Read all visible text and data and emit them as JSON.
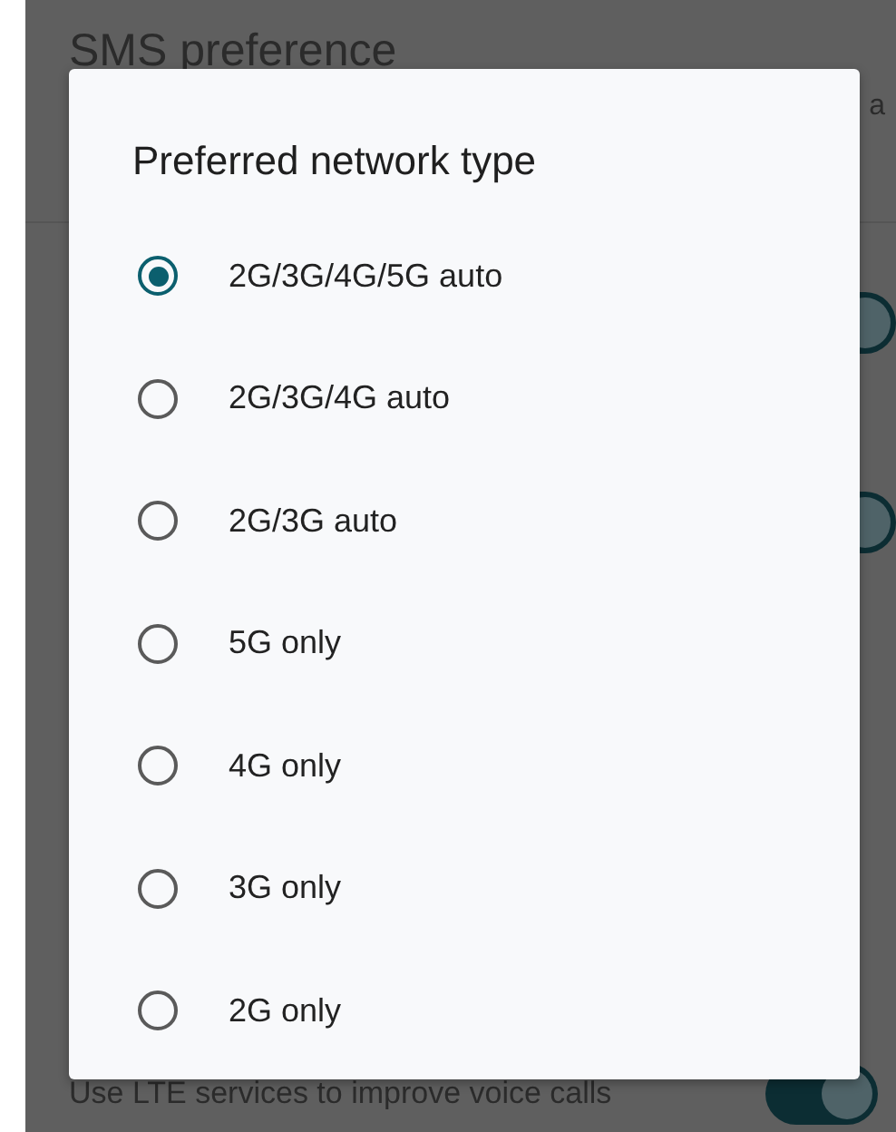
{
  "background": {
    "title": "SMS preference",
    "fragment": "a",
    "toggles": [
      {
        "on": true
      },
      {
        "on": true
      }
    ],
    "lte_text": "Use LTE services to improve voice calls",
    "lte_toggle": {
      "on": true
    }
  },
  "dialog": {
    "title": "Preferred network type",
    "options": [
      {
        "label": "2G/3G/4G/5G auto",
        "selected": true
      },
      {
        "label": "2G/3G/4G auto",
        "selected": false
      },
      {
        "label": "2G/3G auto",
        "selected": false
      },
      {
        "label": "5G only",
        "selected": false
      },
      {
        "label": "4G only",
        "selected": false
      },
      {
        "label": "3G only",
        "selected": false
      },
      {
        "label": "2G only",
        "selected": false
      }
    ]
  }
}
